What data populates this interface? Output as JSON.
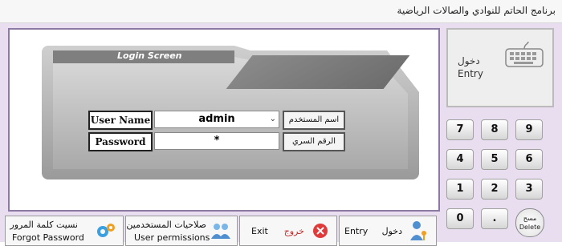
{
  "window": {
    "title": "برنامج الحاتم للنوادي والصالات الرياضية"
  },
  "device": {
    "header": "Login Screen"
  },
  "form": {
    "username_label": "User Name",
    "username_value": "admin",
    "username_label_ar": "اسم المستخدم",
    "password_label": "Password",
    "password_value": "*",
    "password_label_ar": "الرقم السري"
  },
  "entry_panel": {
    "label_ar": "دخول",
    "label_en": "Entry",
    "icon": "keyboard-icon"
  },
  "keypad": {
    "keys": [
      "7",
      "8",
      "9",
      "4",
      "5",
      "6",
      "1",
      "2",
      "3",
      "0",
      "."
    ],
    "delete_ar": "مسح",
    "delete_en": "Delete"
  },
  "bottom_buttons": {
    "forgot": {
      "ar": "نسيت كلمة المرور",
      "en": "Forgot  Password",
      "icon": "gears-icon"
    },
    "permissions": {
      "ar": "صلاحيات المستخدمين",
      "en": "User permissions",
      "icon": "users-icon"
    },
    "exit": {
      "en": "Exit",
      "ar": "خروج",
      "icon": "close-icon"
    },
    "entry": {
      "en": "Entry",
      "ar": "دخول",
      "icon": "user-key-icon"
    }
  },
  "colors": {
    "frame": "#e8def0",
    "border": "#8c7aa5",
    "exit_red": "#e13a3a"
  }
}
